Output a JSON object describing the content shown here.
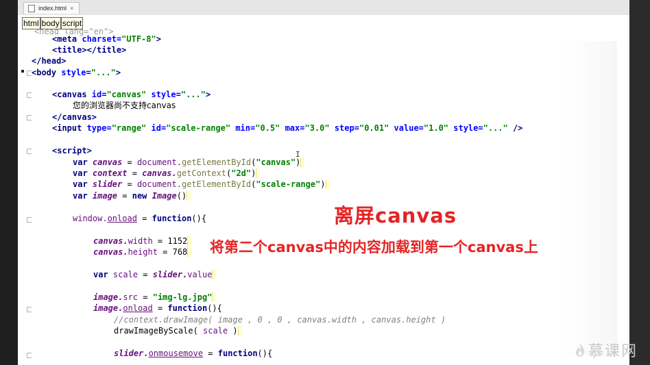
{
  "tab": {
    "filename": "index.html",
    "close": "×"
  },
  "breadcrumb": [
    "html",
    "body",
    "script"
  ],
  "code": {
    "l0": "<head lang=\"en\">",
    "meta_tag": "<meta ",
    "meta_attr": "charset=",
    "meta_val": "\"UTF-8\"",
    "meta_end": ">",
    "title_tag": "<title></title>",
    "head_close": "</head>",
    "body_tag": "<body ",
    "style_attr": "style=",
    "dots": "\"...\"",
    "gt": ">",
    "canvas_tag": "<canvas ",
    "id_attr": "id=",
    "canvas_id": "\"canvas\"",
    "sp_style": " style=",
    "fallback": "您的浏览器尚不支持canvas",
    "canvas_close": "</canvas>",
    "input_tag": "<input ",
    "type_attr": "type=",
    "range_val": "\"range\"",
    "sp_id": " id=",
    "scale_range": "\"scale-range\"",
    "min_attr": " min=",
    "min_val": "\"0.5\"",
    "max_attr": " max=",
    "max_val": "\"3.0\"",
    "step_attr": " step=",
    "step_val": "\"0.01\"",
    "value_attr": " value=",
    "value_val": "\"1.0\"",
    "input_end": " />",
    "script_tag": "<script>",
    "var": "var ",
    "canvas_var": "canvas",
    "assign": " = ",
    "document": "document.",
    "getById": "getElementById",
    "open_paren": "(",
    "close_paren": ")",
    "context_var": "context",
    "canvas_dot": "canvas.",
    "getContext": "getContext",
    "two_d": "\"2d\"",
    "slider_var": "slider",
    "image_var": "image",
    "new_kw": "new ",
    "image_ctor": "Image",
    "parens": "()",
    "window": "window.",
    "onload": "onload",
    "function_kw": "function",
    "fn_open": "(){",
    "width_prop": "width",
    "w_val": " = 1152",
    "height_prop": "height",
    "h_val": " = 768",
    "scale_var": "scale",
    "slider_dot": "slider.",
    "value_prop": "value",
    "image_dot": "image.",
    "src_prop": "src",
    "img_file": "\"img-lg.jpg\"",
    "comment": "//context.drawImage( image , 0 , 0 , canvas.width , canvas.height )",
    "draw_call": "drawImageByScale",
    "draw_args_a": "( ",
    "draw_args_b": " )",
    "onmousemove": "onmousemove"
  },
  "overlay": {
    "title": "离屏canvas",
    "subtitle": "将第二个canvas中的内容加载到第一个canvas上"
  },
  "watermark": {
    "text": "慕课网"
  },
  "colors": {
    "accent_red": "#e32525",
    "tag_blue": "#000080",
    "string_green": "#008000"
  }
}
